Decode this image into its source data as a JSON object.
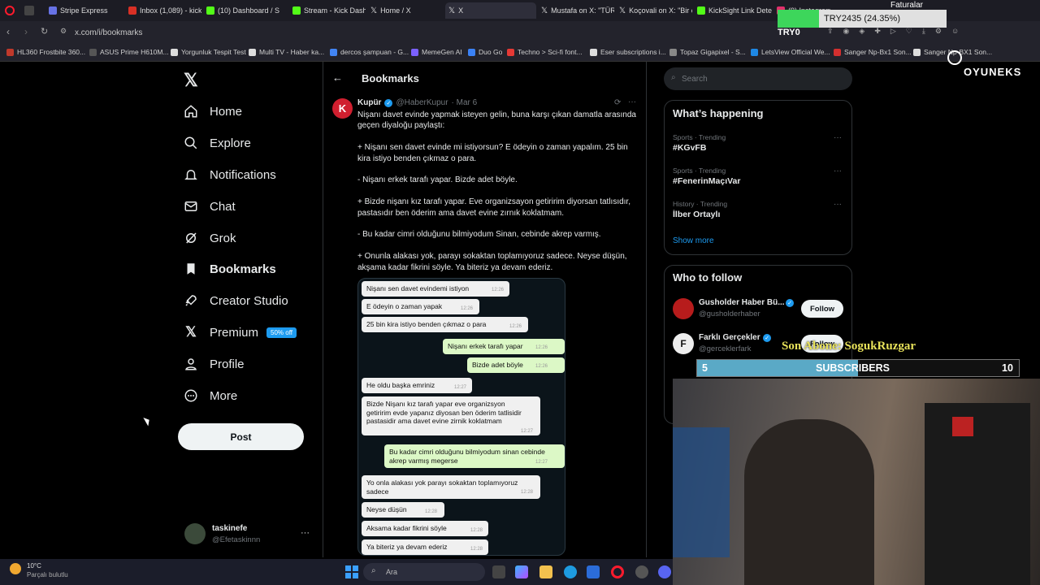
{
  "browser": {
    "tabs": [
      {
        "label": "Stripe Express",
        "color": "#6772e5"
      },
      {
        "label": "Inbox (1,089) - kickta",
        "color": "#d93025"
      },
      {
        "label": "(10) Dashboard / Stre",
        "color": "#53fc18"
      },
      {
        "label": "Stream - Kick Dashb",
        "color": "#53fc18"
      },
      {
        "label": "Home / X",
        "color": "#ffffff"
      },
      {
        "label": "X",
        "color": "#ffffff"
      },
      {
        "label": "Mustafa on X: \"TÜRK",
        "color": "#ffffff"
      },
      {
        "label": "Koçovali on X: \"Bir er",
        "color": "#ffffff"
      },
      {
        "label": "KickSight Link Detect",
        "color": "#53fc18"
      },
      {
        "label": "(9) Instagram",
        "color": "#e1306c"
      }
    ],
    "url": "x.com/i/bookmarks",
    "bookmarks": [
      "HL360 Frostbite 360...",
      "ASUS Prime H610M...",
      "Yorgunluk Tespit Test",
      "Multi TV - Haber ka...",
      "dercos şampuan - G...",
      "MemeGen AI",
      "Duo Go",
      "Techno > Sci-fi font...",
      "Eser subscriptions i...",
      "Topaz Gigapixel - S...",
      "LetsView Official We...",
      "Sanger Np-Bx1 Son...",
      "Sanger Np-BX1 Son..."
    ]
  },
  "sidebar": {
    "items": [
      {
        "label": "Home",
        "icon": "home-icon"
      },
      {
        "label": "Explore",
        "icon": "search-icon"
      },
      {
        "label": "Notifications",
        "icon": "bell-icon"
      },
      {
        "label": "Chat",
        "icon": "mail-icon"
      },
      {
        "label": "Grok",
        "icon": "grok-icon"
      },
      {
        "label": "Bookmarks",
        "icon": "bookmark-icon"
      },
      {
        "label": "Creator Studio",
        "icon": "rocket-icon"
      },
      {
        "label": "Premium",
        "icon": "x-logo-icon"
      },
      {
        "label": "Profile",
        "icon": "person-icon"
      },
      {
        "label": "More",
        "icon": "more-circle-icon"
      }
    ],
    "premium_badge": "50% off",
    "post_label": "Post",
    "account": {
      "name": "taskinefe",
      "handle": "@Efetaskinnn"
    }
  },
  "main": {
    "title": "Bookmarks",
    "tweet": {
      "author": "Kupür",
      "handle": "@HaberKupur",
      "date": "· Mar 6",
      "avatar_letter": "K",
      "text": "Nişanı davet evinde yapmak isteyen gelin, buna karşı çıkan damatla arasında geçen diyaloğu paylaştı:\n\n+ Nişanı sen davet evinde mi istiyorsun? E ödeyin o zaman yapalım. 25 bin kira istiyo benden çıkmaz o para.\n\n- Nişanı erkek tarafı yapar. Bizde adet böyle.\n\n+ Bizde nişanı kız tarafı yapar. Eve organizsayon getiririm diyorsan tatlısıdır, pastasıdır ben öderim ama davet evine zırnık koklatmam.\n\n- Bu kadar cimri olduğunu bilmiyodum Sinan, cebinde akrep varmış.\n\n+ Onunla alakası yok, parayı sokaktan toplamıyoruz sadece. Neyse düşün, akşama kadar fikrini söyle. Ya biteriz ya devam ederiz."
    },
    "chat": [
      {
        "side": "in",
        "text": "Nişanı sen davet evindemi istiyon",
        "time": "12:26"
      },
      {
        "side": "in",
        "text": "E ödeyin o zaman yapak",
        "time": "12:26"
      },
      {
        "side": "in",
        "text": "25 bin kira istiyo benden çıkmaz o para",
        "time": "12:26"
      },
      {
        "side": "out",
        "text": "Nişanı erkek tarafı yapar",
        "time": "12:26"
      },
      {
        "side": "out",
        "text": "Bizde adet böyle",
        "time": "12:26"
      },
      {
        "side": "in",
        "text": "He oldu başka emriniz",
        "time": "12:27"
      },
      {
        "side": "in",
        "text": "Bizde Nişanı kız tarafı yapar eve organizsyon\ngetiririm evde yapanız diyosan ben öderim tatlisidir\npastasidir ama davet evine zirnik koklatmam",
        "time": "12:27"
      },
      {
        "side": "out",
        "text": "Bu kadar cimri olduğunu bilmiyodum sinan cebinde\nakrep varmış megerse",
        "time": "12:27"
      },
      {
        "side": "in",
        "text": "Yo onla alakası yok parayı sokaktan toplamıyoruz\nsadece",
        "time": "12:28"
      },
      {
        "side": "in",
        "text": "Neyse düşün",
        "time": "12:28"
      },
      {
        "side": "in",
        "text": "Aksama kadar fikrini söyle",
        "time": "12:28"
      },
      {
        "side": "in",
        "text": "Ya biteriz ya devam ederiz",
        "time": "12:28"
      }
    ]
  },
  "right": {
    "search_placeholder": "Search",
    "happening_title": "What’s happening",
    "trends": [
      {
        "meta": "Sports · Trending",
        "name": "#KGvFB"
      },
      {
        "meta": "Sports · Trending",
        "name": "#FenerinMaçıVar"
      },
      {
        "meta": "History · Trending",
        "name": "İlber Ortaylı"
      }
    ],
    "show_more": "Show more",
    "who_title": "Who to follow",
    "follow": [
      {
        "name": "Gusholder Haber Bü...",
        "handle": "@gusholderhaber",
        "button": "Follow"
      },
      {
        "name": "Farklı Gerçekler",
        "handle": "@gerceklerfark",
        "button": "Follow"
      }
    ]
  },
  "overlay": {
    "try_goal": "TRY2435 (24.35%)",
    "try_progress": 0.2435,
    "try_left": "TRY0",
    "faturalar": "Faturalar",
    "brand": "OYUNEKS",
    "last_sub": "Son Abone: SogukRuzgar",
    "sub_current": "5",
    "sub_label": "SUBSCRIBERS",
    "sub_goal": "10",
    "sub_progress": 0.5
  },
  "taskbar": {
    "weather_temp": "10°C",
    "weather_desc": "Parçalı bulutlu",
    "search_placeholder": "Ara"
  }
}
